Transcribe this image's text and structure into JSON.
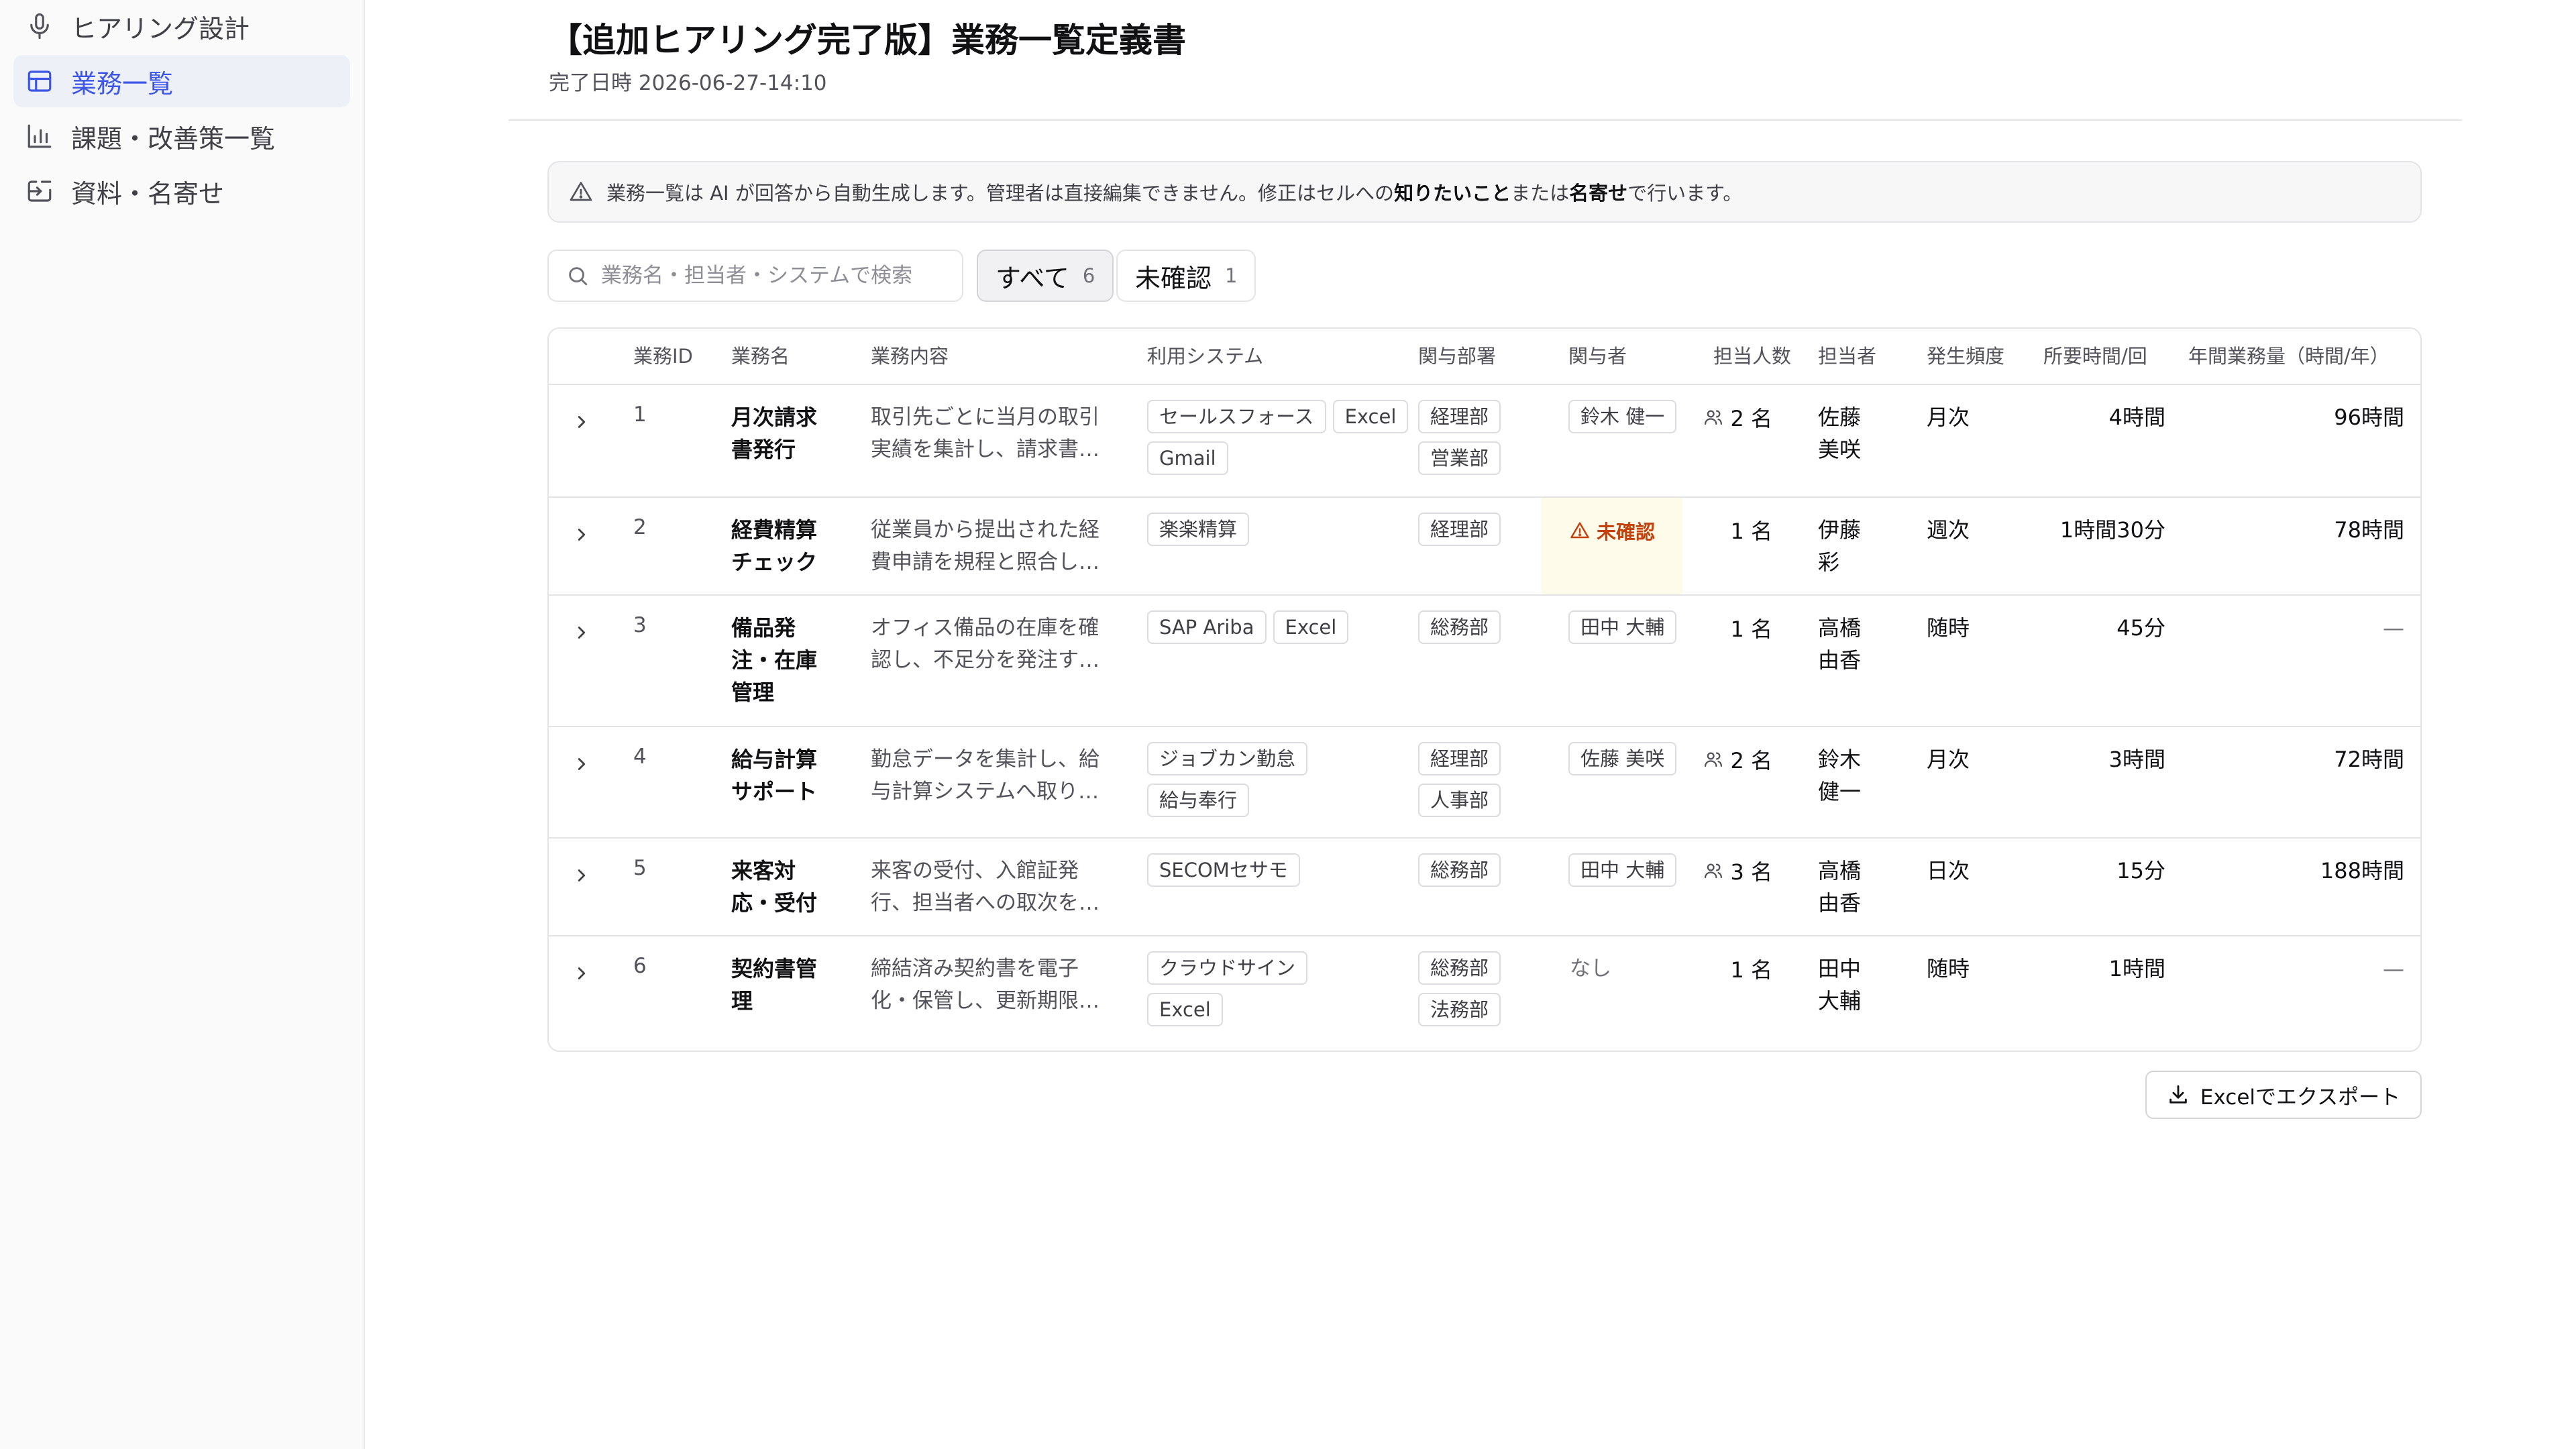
{
  "sidebar": {
    "items": [
      {
        "label": "ヒアリング設計",
        "icon": "microphone-icon",
        "active": false
      },
      {
        "label": "業務一覧",
        "icon": "table-icon",
        "active": true
      },
      {
        "label": "課題・改善策一覧",
        "icon": "bar-chart-icon",
        "active": false
      },
      {
        "label": "資料・名寄せ",
        "icon": "import-icon",
        "active": false
      }
    ]
  },
  "header": {
    "title": "【追加ヒアリング完了版】業務一覧定義書",
    "completed_at": "完了日時 2026-06-27-14:10"
  },
  "notice": {
    "icon": "warning-icon",
    "text_pre": "業務一覧は AI が回答から自動生成します。管理者は直接編集できません。修正はセルへの",
    "emphasis_1": "知りたいこと",
    "text_mid": "または",
    "emphasis_2": "名寄せ",
    "text_post": "で行います。"
  },
  "search": {
    "placeholder": "業務名・担当者・システムで検索",
    "value": ""
  },
  "filters": [
    {
      "label": "すべて",
      "count": "6",
      "active": true
    },
    {
      "label": "未確認",
      "count": "1",
      "active": false
    }
  ],
  "table": {
    "columns": {
      "id": "業務ID",
      "name": "業務名",
      "description": "業務内容",
      "systems": "利用システム",
      "departments": "関与部署",
      "participants": "関与者",
      "headcount": "担当人数",
      "owner": "担当者",
      "frequency": "発生頻度",
      "time_per_run": "所要時間/回",
      "annual_hours": "年間業務量（時間/年）"
    },
    "rows": [
      {
        "id": "1",
        "name": [
          "月次請求",
          "書発行"
        ],
        "description": [
          "取引先ごとに当月の取引",
          "実績を集計し、請求書…"
        ],
        "systems": [
          "セールスフォース",
          "Excel",
          "Gmail"
        ],
        "departments": [
          "経理部",
          "営業部"
        ],
        "participants": [
          "鈴木 健一"
        ],
        "participant_status": "",
        "headcount": "2 名",
        "headcount_icon": true,
        "owner": [
          "佐藤",
          "美咲"
        ],
        "frequency": "月次",
        "time_per_run": "4時間",
        "annual_hours": "96時間"
      },
      {
        "id": "2",
        "name": [
          "経費精算",
          "チェック"
        ],
        "description": [
          "従業員から提出された経",
          "費申請を規程と照合し…"
        ],
        "systems": [
          "楽楽精算"
        ],
        "departments": [
          "経理部"
        ],
        "participants": [],
        "participant_status": "未確認",
        "headcount": "1 名",
        "headcount_icon": false,
        "owner": [
          "伊藤",
          "彩"
        ],
        "frequency": "週次",
        "time_per_run": "1時間30分",
        "annual_hours": "78時間"
      },
      {
        "id": "3",
        "name": [
          "備品発",
          "注・在庫",
          "管理"
        ],
        "description": [
          "オフィス備品の在庫を確",
          "認し、不足分を発注す…"
        ],
        "systems": [
          "SAP Ariba",
          "Excel"
        ],
        "departments": [
          "総務部"
        ],
        "participants": [
          "田中 大輔"
        ],
        "participant_status": "",
        "headcount": "1 名",
        "headcount_icon": false,
        "owner": [
          "高橋",
          "由香"
        ],
        "frequency": "随時",
        "time_per_run": "45分",
        "annual_hours": "—"
      },
      {
        "id": "4",
        "name": [
          "給与計算",
          "サポート"
        ],
        "description": [
          "勤怠データを集計し、給",
          "与計算システムへ取り…"
        ],
        "systems": [
          "ジョブカン勤怠",
          "給与奉行"
        ],
        "departments": [
          "経理部",
          "人事部"
        ],
        "participants": [
          "佐藤 美咲"
        ],
        "participant_status": "",
        "headcount": "2 名",
        "headcount_icon": true,
        "owner": [
          "鈴木",
          "健一"
        ],
        "frequency": "月次",
        "time_per_run": "3時間",
        "annual_hours": "72時間"
      },
      {
        "id": "5",
        "name": [
          "来客対",
          "応・受付"
        ],
        "description": [
          "来客の受付、入館証発",
          "行、担当者への取次を…"
        ],
        "systems": [
          "SECOMセサモ"
        ],
        "departments": [
          "総務部"
        ],
        "participants": [
          "田中 大輔"
        ],
        "participant_status": "",
        "headcount": "3 名",
        "headcount_icon": true,
        "owner": [
          "高橋",
          "由香"
        ],
        "frequency": "日次",
        "time_per_run": "15分",
        "annual_hours": "188時間"
      },
      {
        "id": "6",
        "name": [
          "契約書管",
          "理"
        ],
        "description": [
          "締結済み契約書を電子",
          "化・保管し、更新期限…"
        ],
        "systems": [
          "クラウドサイン",
          "Excel"
        ],
        "departments": [
          "総務部",
          "法務部"
        ],
        "participants": [],
        "participant_status": "なし",
        "headcount": "1 名",
        "headcount_icon": false,
        "owner": [
          "田中",
          "大輔"
        ],
        "frequency": "随時",
        "time_per_run": "1時間",
        "annual_hours": "—"
      }
    ]
  },
  "export": {
    "label": "Excelでエクスポート",
    "icon": "download-icon"
  },
  "colors": {
    "accent": "#3b55e6",
    "active_nav_bg": "#eef0f7",
    "warning_text": "#c2410c",
    "warning_bg": "#fffbeb",
    "border": "#e4e4e7"
  }
}
